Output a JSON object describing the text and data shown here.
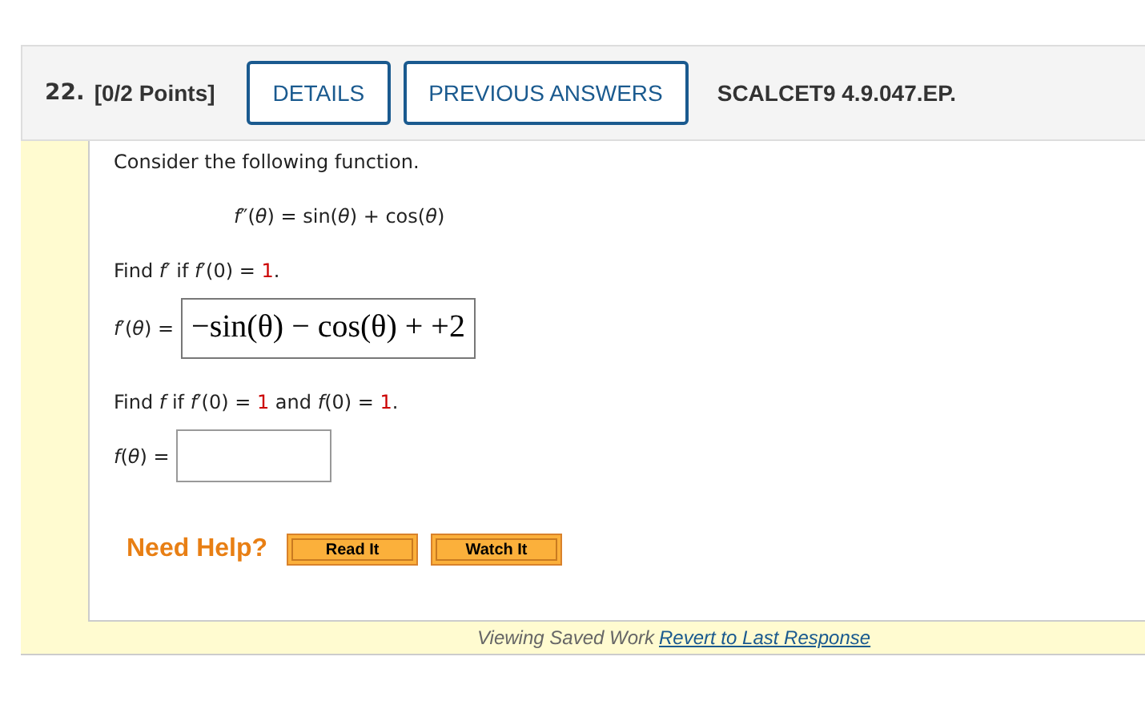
{
  "header": {
    "number": "22.",
    "points": "[0/2 Points]",
    "buttons": [
      "DETAILS",
      "PREVIOUS ANSWERS"
    ],
    "code": "SCALCET9 4.9.047.EP."
  },
  "question": {
    "intro": "Consider the following function.",
    "equation": [
      {
        "kind": "italic",
        "text": "f"
      },
      {
        "kind": "plain",
        "text": "″("
      },
      {
        "kind": "italic",
        "text": "θ"
      },
      {
        "kind": "plain",
        "text": ") = sin("
      },
      {
        "kind": "italic",
        "text": "θ"
      },
      {
        "kind": "plain",
        "text": ") + cos("
      },
      {
        "kind": "italic",
        "text": "θ"
      },
      {
        "kind": "plain",
        "text": ")"
      }
    ],
    "parts": [
      {
        "prompt": [
          {
            "kind": "plain",
            "text": "Find "
          },
          {
            "kind": "italic",
            "text": "f′"
          },
          {
            "kind": "plain",
            "text": " if "
          },
          {
            "kind": "italic",
            "text": "f"
          },
          {
            "kind": "plain",
            "text": "′(0) = "
          },
          {
            "kind": "given",
            "text": "1"
          },
          {
            "kind": "plain",
            "text": "."
          }
        ],
        "label": [
          {
            "kind": "italic",
            "text": "f"
          },
          {
            "kind": "plain",
            "text": "′("
          },
          {
            "kind": "italic",
            "text": "θ"
          },
          {
            "kind": "plain",
            "text": ") ="
          }
        ],
        "answer": "−sin(θ) − cos(θ) + +2"
      },
      {
        "prompt": [
          {
            "kind": "plain",
            "text": "Find "
          },
          {
            "kind": "italic",
            "text": "f"
          },
          {
            "kind": "plain",
            "text": " if "
          },
          {
            "kind": "italic",
            "text": "f"
          },
          {
            "kind": "plain",
            "text": "′(0) = "
          },
          {
            "kind": "given",
            "text": "1"
          },
          {
            "kind": "plain",
            "text": " and "
          },
          {
            "kind": "italic",
            "text": "f"
          },
          {
            "kind": "plain",
            "text": "(0) = "
          },
          {
            "kind": "given",
            "text": "1"
          },
          {
            "kind": "plain",
            "text": "."
          }
        ],
        "label": [
          {
            "kind": "italic",
            "text": "f"
          },
          {
            "kind": "plain",
            "text": "("
          },
          {
            "kind": "italic",
            "text": "θ"
          },
          {
            "kind": "plain",
            "text": ") ="
          }
        ]
      }
    ]
  },
  "help": {
    "label": "Need Help?",
    "buttons": [
      "Read It",
      "Watch It"
    ]
  },
  "footer": {
    "text": "Viewing Saved Work",
    "link": "Revert to Last Response"
  }
}
